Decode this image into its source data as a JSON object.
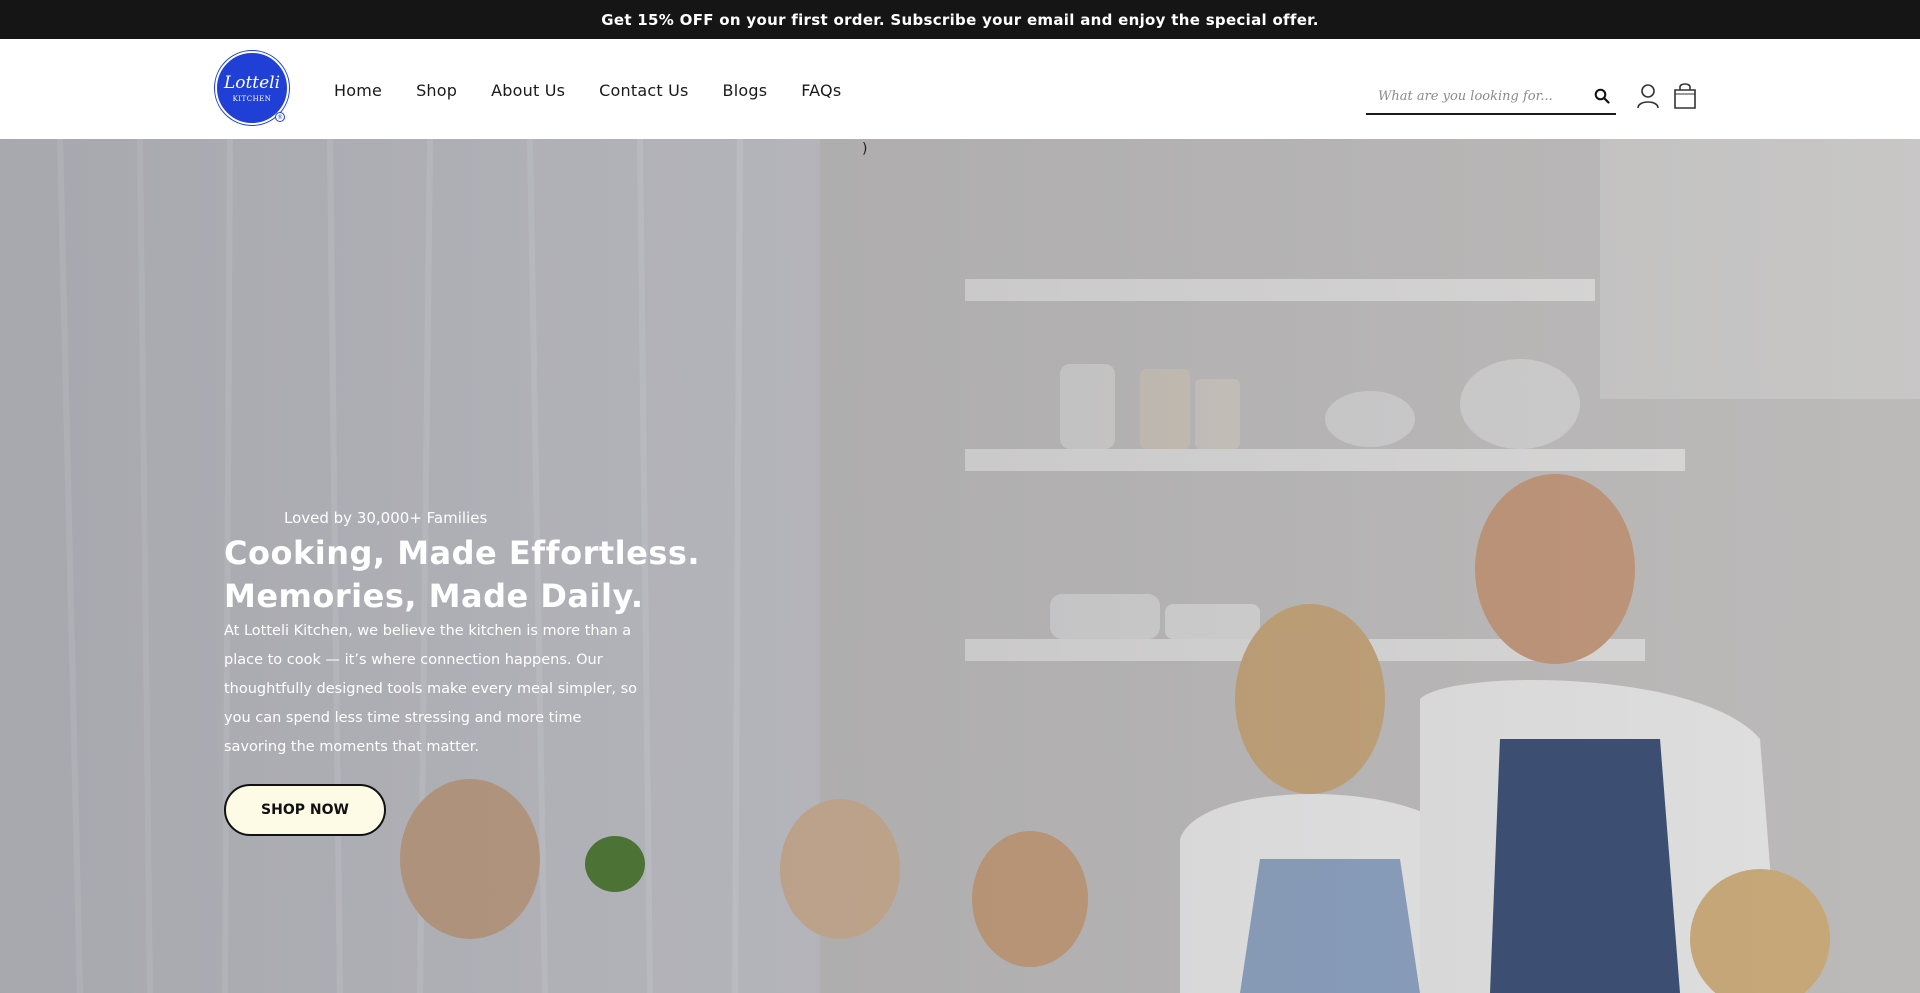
{
  "announcement": "Get 15% OFF on your first order. Subscribe your email and enjoy the special offer.",
  "logo": {
    "text": "Lotteli",
    "sub": "KITCHEN",
    "mark": "®",
    "color": "#1f3fd6"
  },
  "nav": [
    {
      "label": "Home"
    },
    {
      "label": "Shop"
    },
    {
      "label": "About Us"
    },
    {
      "label": "Contact Us"
    },
    {
      "label": "Blogs"
    },
    {
      "label": "FAQs"
    }
  ],
  "search": {
    "placeholder": "What are you looking for..."
  },
  "icons": {
    "search": "search-icon",
    "account": "user-icon",
    "cart": "shopping-bag-icon"
  },
  "hero": {
    "stray": ")",
    "eyebrow": "Loved by 30,000+ Families",
    "headline": [
      "Cooking, Made Effortless.",
      "Memories, Made Daily."
    ],
    "lede": "At Lotteli Kitchen, we believe the kitchen is more than a place to cook — it’s where connection happens. Our thoughtfully designed tools make every meal simpler, so you can spend less time stressing and more time savoring the moments that matter.",
    "cta": "SHOP NOW"
  }
}
